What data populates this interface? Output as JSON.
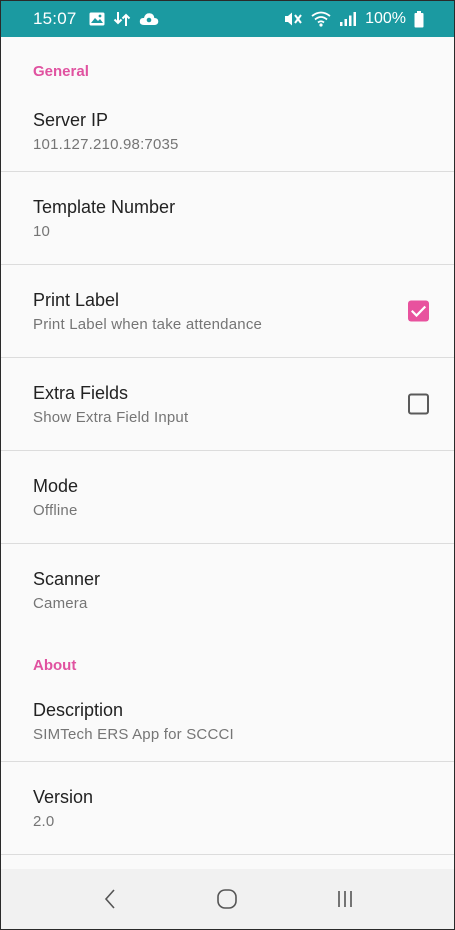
{
  "status_bar": {
    "time": "15:07",
    "battery": "100%",
    "background_color": "#1b9aa1",
    "icons": [
      "gallery-icon",
      "data-sync-icon",
      "cloud-icon",
      "mute-icon",
      "wifi-icon",
      "signal-icon",
      "battery-icon"
    ]
  },
  "settings": {
    "accent_color": "#e052a0",
    "general": {
      "header": "General",
      "server_ip": {
        "title": "Server IP",
        "summary": "101.127.210.98:7035"
      },
      "template_number": {
        "title": "Template Number",
        "summary": "10"
      },
      "print_label": {
        "title": "Print Label",
        "summary": "Print Label when take attendance",
        "checked": true
      },
      "extra_fields": {
        "title": "Extra Fields",
        "summary": "Show Extra Field Input",
        "checked": false
      },
      "mode": {
        "title": "Mode",
        "summary": "Offline"
      },
      "scanner": {
        "title": "Scanner",
        "summary": "Camera"
      }
    },
    "about": {
      "header": "About",
      "description": {
        "title": "Description",
        "summary": "SIMTech ERS App for SCCCI"
      },
      "version": {
        "title": "Version",
        "summary": "2.0"
      }
    }
  },
  "nav_bar": {
    "icons": [
      "back-icon",
      "home-icon",
      "recents-icon"
    ]
  }
}
